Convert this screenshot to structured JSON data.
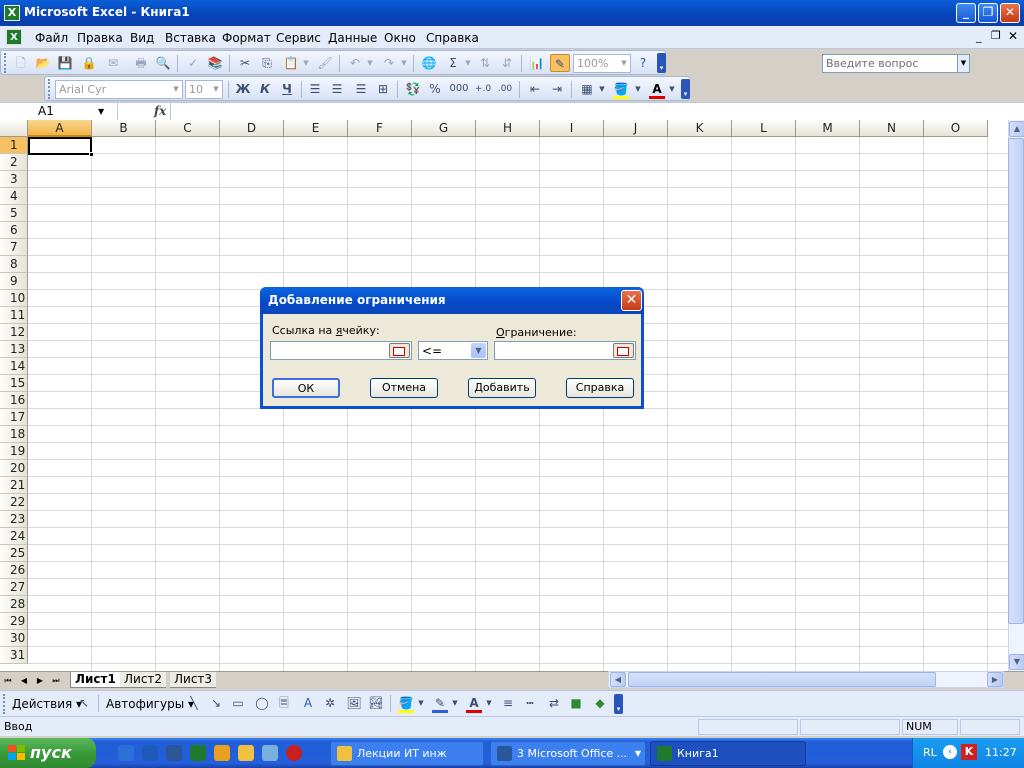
{
  "window": {
    "title": "Microsoft Excel - Книга1",
    "app_icon": "excel-icon"
  },
  "menu": {
    "items": [
      "Файл",
      "Правка",
      "Вид",
      "Вставка",
      "Формат",
      "Сервис",
      "Данные",
      "Окно",
      "Справка"
    ],
    "ask_placeholder": "Введите вопрос"
  },
  "toolbar": {
    "zoom": "100%",
    "font_name": "Arial Cyr",
    "font_size": "10",
    "bold": "Ж",
    "italic": "К",
    "underline": "Ч",
    "percent": "%",
    "thousands": "000",
    "sum": "Σ"
  },
  "formula_bar": {
    "name_box": "A1",
    "fx": "fx"
  },
  "grid": {
    "columns": [
      "A",
      "B",
      "C",
      "D",
      "E",
      "F",
      "G",
      "H",
      "I",
      "J",
      "K",
      "L",
      "M",
      "N",
      "O"
    ],
    "rows": [
      "1",
      "2",
      "3",
      "4",
      "5",
      "6",
      "7",
      "8",
      "9",
      "10",
      "11",
      "12",
      "13",
      "14",
      "15",
      "16",
      "17",
      "18",
      "19",
      "20",
      "21",
      "22",
      "23",
      "24",
      "25",
      "26",
      "27",
      "28",
      "29",
      "30",
      "31"
    ],
    "selected_column": "A",
    "selected_row": "1"
  },
  "sheets": {
    "tabs": [
      "Лист1",
      "Лист2",
      "Лист3"
    ],
    "active": "Лист1"
  },
  "drawing": {
    "actions": "Действия",
    "autoshapes": "Автофигуры"
  },
  "status": {
    "mode": "Ввод",
    "num": "NUM"
  },
  "dialog": {
    "title": "Добавление ограничения",
    "cell_ref_label_pre": "Ссылка на ",
    "cell_ref_label_u": "я",
    "cell_ref_label_post": "чейку:",
    "constraint_label_pre": "",
    "constraint_label_u": "О",
    "constraint_label_post": "граничение:",
    "cell_ref_value": "",
    "operator": "<=",
    "constraint_value": "",
    "buttons": {
      "ok": "ОК",
      "cancel": "Отмена",
      "add_u": "Д",
      "add_rest": "обавить",
      "help": "Справка"
    }
  },
  "taskbar": {
    "start": "пуск",
    "items": [
      {
        "label": "Лекции ИТ инж"
      },
      {
        "label": "3 Microsoft Office ..."
      },
      {
        "label": "Книга1"
      }
    ],
    "tray": {
      "lang": "RL",
      "clock": "11:27"
    }
  },
  "colors": {
    "title_blue": "#0842b8",
    "selection_orange": "#f6c063",
    "taskbar_blue": "#245edb",
    "start_green": "#3a9a3a"
  }
}
